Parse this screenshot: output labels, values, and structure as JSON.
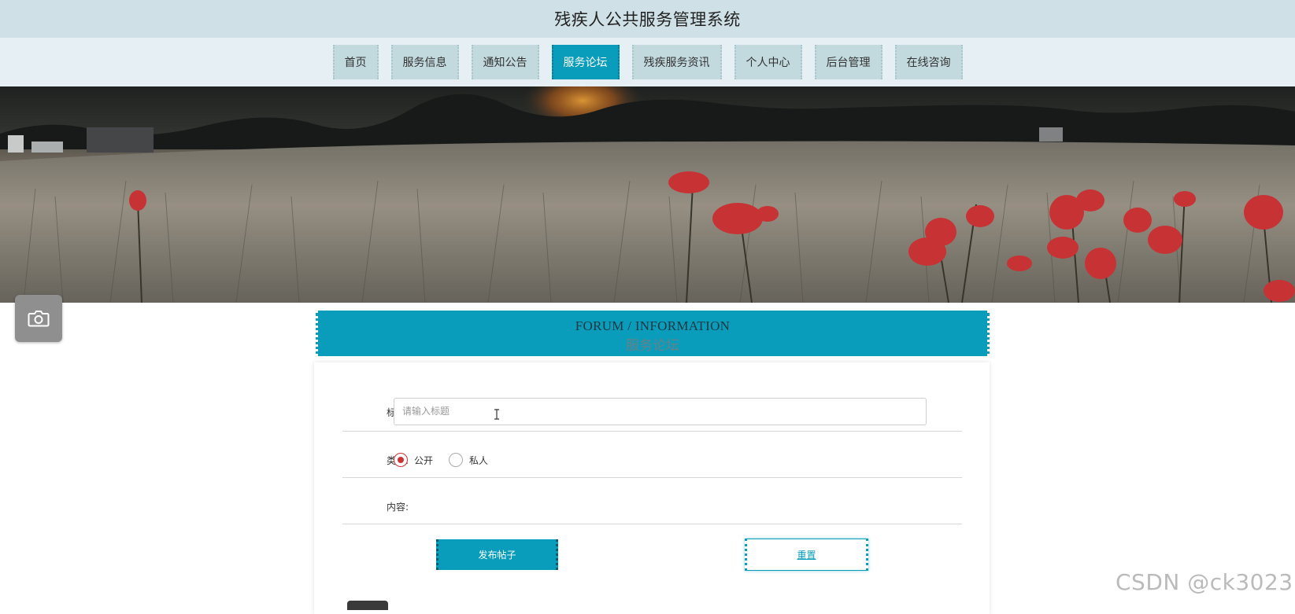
{
  "app": {
    "title": "残疾人公共服务管理系统"
  },
  "nav": {
    "items": [
      {
        "label": "首页",
        "active": false
      },
      {
        "label": "服务信息",
        "active": false
      },
      {
        "label": "通知公告",
        "active": false
      },
      {
        "label": "服务论坛",
        "active": true
      },
      {
        "label": "残疾服务资讯",
        "active": false
      },
      {
        "label": "个人中心",
        "active": false
      },
      {
        "label": "后台管理",
        "active": false
      },
      {
        "label": "在线咨询",
        "active": false
      }
    ]
  },
  "section": {
    "title_en": "FORUM / INFORMATION",
    "title_cn": "服务论坛"
  },
  "form": {
    "title_label": "标题:",
    "title_placeholder": "请输入标题",
    "title_value": "",
    "type_label": "类型:",
    "type_options": [
      {
        "label": "公开",
        "checked": true
      },
      {
        "label": "私人",
        "checked": false
      }
    ],
    "content_label": "内容:",
    "publish_button": "发布帖子",
    "reset_button": "重置"
  },
  "watermark": "CSDN @ck3023",
  "colors": {
    "accent": "#0a9dbb",
    "topbar": "#cfe1e7",
    "navbar": "#e6eff3",
    "nav_item": "#c2dade",
    "radio_checked": "#cc3333"
  },
  "icons": {
    "camera": "camera-icon"
  }
}
